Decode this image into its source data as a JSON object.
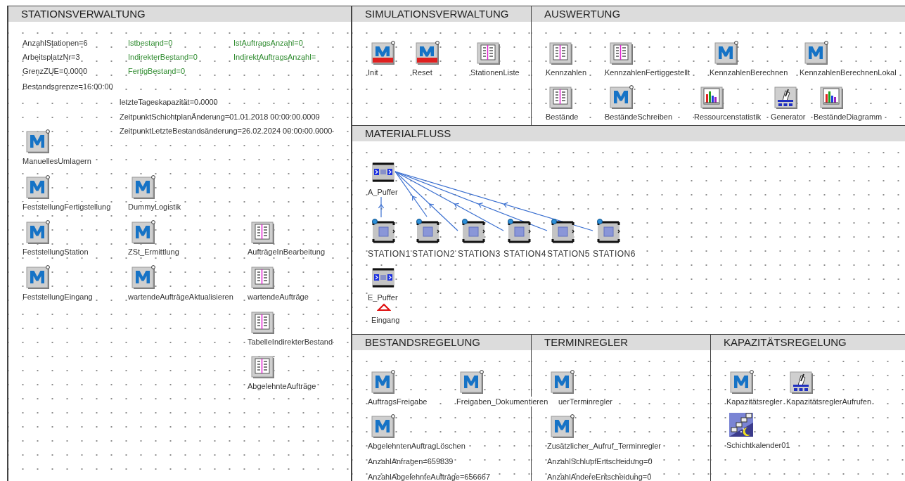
{
  "frames": [
    {
      "title": "STATIONSVERWALTUNG",
      "items": [
        {
          "kind": "variable",
          "text": "AnzahlStationen=6",
          "color": "#333333"
        },
        {
          "kind": "variable",
          "text": "Istbestand=0",
          "color": "#2e8b2e"
        },
        {
          "kind": "variable",
          "text": "IstAuftragsAnzahl=0",
          "color": "#2e8b2e"
        },
        {
          "kind": "variable",
          "text": "ArbeitsplatzNr=3",
          "color": "#333333"
        },
        {
          "kind": "variable",
          "text": "IndirekterBestand=0",
          "color": "#2e8b2e"
        },
        {
          "kind": "variable",
          "text": "IndirektAuftragsAnzahl=",
          "color": "#2e8b2e"
        },
        {
          "kind": "variable",
          "text": "GrenzZUE=0.0000",
          "color": "#333333"
        },
        {
          "kind": "variable",
          "text": "FertigBestand=0",
          "color": "#2e8b2e"
        },
        {
          "kind": "variable",
          "text": "Bestandsgrenze=16:00:00",
          "color": "#333333"
        },
        {
          "kind": "variable",
          "text": "letzteTageskapazität=0.0000",
          "color": "#333333"
        },
        {
          "kind": "variable",
          "text": "ZeitpunktSchichtplanÄnderung=01.01.2018 00:00:00.0000",
          "color": "#333333"
        },
        {
          "kind": "variable",
          "text": "ZeitpunktLetzteBestandsänderung=26.02.2024 00:00:00.0000",
          "color": "#333333"
        },
        {
          "kind": "method",
          "label": "ManuellesUmlagern"
        },
        {
          "kind": "method",
          "label": "FeststellungFertigstellung"
        },
        {
          "kind": "method",
          "label": "DummyLogistik"
        },
        {
          "kind": "method",
          "label": "FeststellungStation"
        },
        {
          "kind": "method",
          "label": "ZSt_Ermittlung"
        },
        {
          "kind": "table",
          "label": "AufträgeInBearbeitung"
        },
        {
          "kind": "method",
          "label": "FeststellungEingang"
        },
        {
          "kind": "method",
          "label": "wartendeAufträgeAktualisieren"
        },
        {
          "kind": "table",
          "label": "wartendeAufträge"
        },
        {
          "kind": "table",
          "label": "TabelleIndirekterBestand"
        },
        {
          "kind": "table",
          "label": "AbgelehnteAufträge"
        }
      ]
    },
    {
      "title": "SIMULATIONSVERWALTUNG",
      "items": [
        {
          "kind": "init_method",
          "label": "Init"
        },
        {
          "kind": "init_method",
          "label": "Reset"
        },
        {
          "kind": "table",
          "label": "StationenListe"
        }
      ]
    },
    {
      "title": "AUSWERTUNG",
      "items": [
        {
          "kind": "table",
          "label": "Kennzahlen"
        },
        {
          "kind": "table",
          "label": "KennzahlenFertiggestellt"
        },
        {
          "kind": "method",
          "label": "KennzahlenBerechnen"
        },
        {
          "kind": "method",
          "label": "KennzahlenBerechnenLokal"
        },
        {
          "kind": "table",
          "label": "Bestände"
        },
        {
          "kind": "method",
          "label": "BeständeSchreiben"
        },
        {
          "kind": "chart",
          "label": "Ressourcenstatistik"
        },
        {
          "kind": "generator",
          "label": "Generator"
        },
        {
          "kind": "chart",
          "label": "BeständeDiagramm"
        }
      ]
    },
    {
      "title": "MATERIALFLUSS",
      "items": [
        {
          "kind": "buffer",
          "label": "A_Puffer"
        },
        {
          "kind": "station",
          "label": "STATION1"
        },
        {
          "kind": "station",
          "label": "STATION2"
        },
        {
          "kind": "station",
          "label": "STATION3"
        },
        {
          "kind": "station",
          "label": "STATION4"
        },
        {
          "kind": "station",
          "label": "STATION5"
        },
        {
          "kind": "station",
          "label": "STATION6"
        },
        {
          "kind": "buffer",
          "label": "E_Puffer"
        },
        {
          "kind": "source",
          "label": "Eingang"
        }
      ]
    },
    {
      "title": "BESTANDSREGELUNG",
      "items": [
        {
          "kind": "method",
          "label": "AuftragsFreigabe"
        },
        {
          "kind": "method",
          "label": "Freigaben_Dokumentieren"
        },
        {
          "kind": "method",
          "label": "AbgelehntenAuftragLöschen"
        },
        {
          "kind": "variable",
          "text": "AnzahlAnfragen=659839",
          "color": "#333333"
        },
        {
          "kind": "variable",
          "text": "AnzahlAbgelehnteAufträge=656667",
          "color": "#333333"
        }
      ]
    },
    {
      "title": "TERMINREGLER",
      "items": [
        {
          "kind": "method",
          "label": "uerTerminregler"
        },
        {
          "kind": "method",
          "label": "Zusätzlicher_Aufruf_Terminregler"
        },
        {
          "kind": "variable",
          "text": "AnzahlSchlupfEntscheidung=0",
          "color": "#333333"
        },
        {
          "kind": "variable",
          "text": "AnzahlAndereEntscheidung=0",
          "color": "#333333"
        }
      ]
    },
    {
      "title": "KAPAZITÄTSREGELUNG",
      "items": [
        {
          "kind": "method",
          "label": "Kapazitätsregler"
        },
        {
          "kind": "generator",
          "label": "KapazitätsreglerAufrufen"
        },
        {
          "kind": "calendar",
          "label": "Schichtkalender01"
        }
      ]
    }
  ]
}
